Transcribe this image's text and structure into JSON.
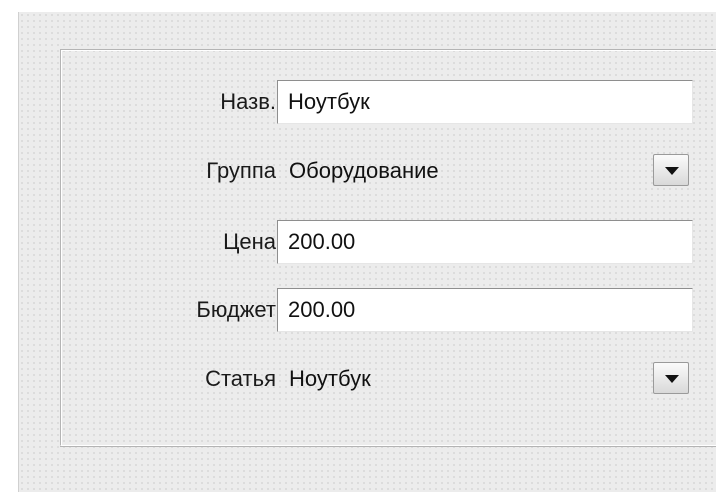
{
  "form": {
    "fields": [
      {
        "label": "Назв.",
        "value": "Ноутбук",
        "type": "text"
      },
      {
        "label": "Группа",
        "value": "Оборудование",
        "type": "select"
      },
      {
        "label": "Цена",
        "value": "200.00",
        "type": "text"
      },
      {
        "label": "Бюджет",
        "value": "200.00",
        "type": "text"
      },
      {
        "label": "Статья",
        "value": "Ноутбук",
        "type": "select"
      }
    ],
    "dropdown_icon": "chevron-down-icon"
  },
  "colors": {
    "background": "#ececec",
    "field_background": "#ffffff",
    "text": "#111111"
  }
}
